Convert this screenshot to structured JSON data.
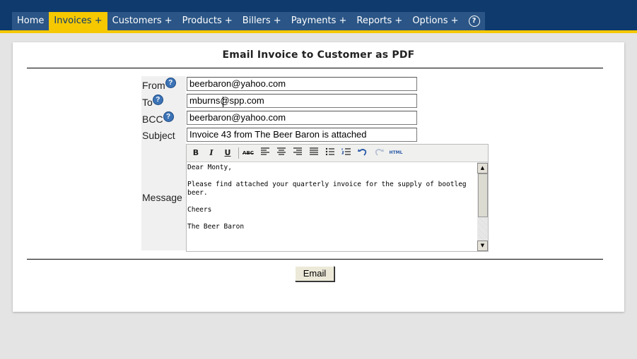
{
  "nav": {
    "items": [
      {
        "label": "Home"
      },
      {
        "label": "Invoices +",
        "active": true
      },
      {
        "label": "Customers +"
      },
      {
        "label": "Products +"
      },
      {
        "label": "Billers +"
      },
      {
        "label": "Payments +"
      },
      {
        "label": "Reports +"
      },
      {
        "label": "Options +"
      }
    ],
    "help_icon": "help-circle-icon"
  },
  "form": {
    "title": "Email Invoice to Customer as PDF",
    "from_label": "From",
    "from_value": "beerbaron@yahoo.com",
    "to_label": "To",
    "to_value": "mburns@spp.com",
    "bcc_label": "BCC",
    "bcc_value": "beerbaron@yahoo.com",
    "subject_label": "Subject",
    "subject_value": "Invoice 43 from The Beer Baron is attached",
    "message_label": "Message",
    "message_lines": [
      "Dear Monty,",
      "",
      "Please find attached your quarterly invoice for the supply of bootleg",
      "beer.",
      "",
      "Cheers",
      "",
      "The Beer Baron"
    ],
    "submit_label": "Email",
    "help_glyph": "?"
  },
  "toolbar": {
    "bold": "B",
    "italic": "I",
    "underline": "U",
    "strikethrough": "ABC",
    "html": "HTML"
  },
  "colors": {
    "topbar": "#0e3a6e",
    "accent": "#f5c800",
    "help": "#3c73b6"
  }
}
